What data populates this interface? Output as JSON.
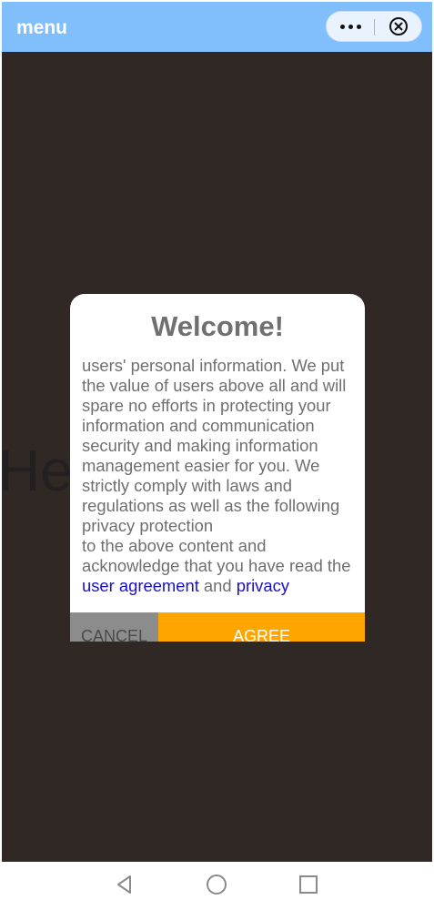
{
  "topbar": {
    "title": "menu",
    "more_icon": "more-dots-icon",
    "close_icon": "circle-close-icon"
  },
  "background": {
    "text": "He"
  },
  "dialog": {
    "title": "Welcome!",
    "body_top": "users' personal information. We put the value of users above all and will spare no efforts in protecting your information and communication security and making information management easier for you. We strictly comply with laws and regulations as well as the following privacy protection",
    "body_bottom_prefix": "to the above content and acknowledge that you have read the ",
    "user_agreement_link": "user agreement",
    "and_text": " and ",
    "privacy_link": "privacy",
    "cancel_label": "CANCEL",
    "agree_label": "AGREE"
  },
  "navbar": {
    "back_icon": "back-triangle-icon",
    "home_icon": "home-circle-icon",
    "recents_icon": "recents-square-icon"
  },
  "colors": {
    "topbar": "#80bffb",
    "page_background": "#302825",
    "agree_button": "#ffa500",
    "cancel_button": "#8c8c8c",
    "link": "#1a10c8"
  }
}
